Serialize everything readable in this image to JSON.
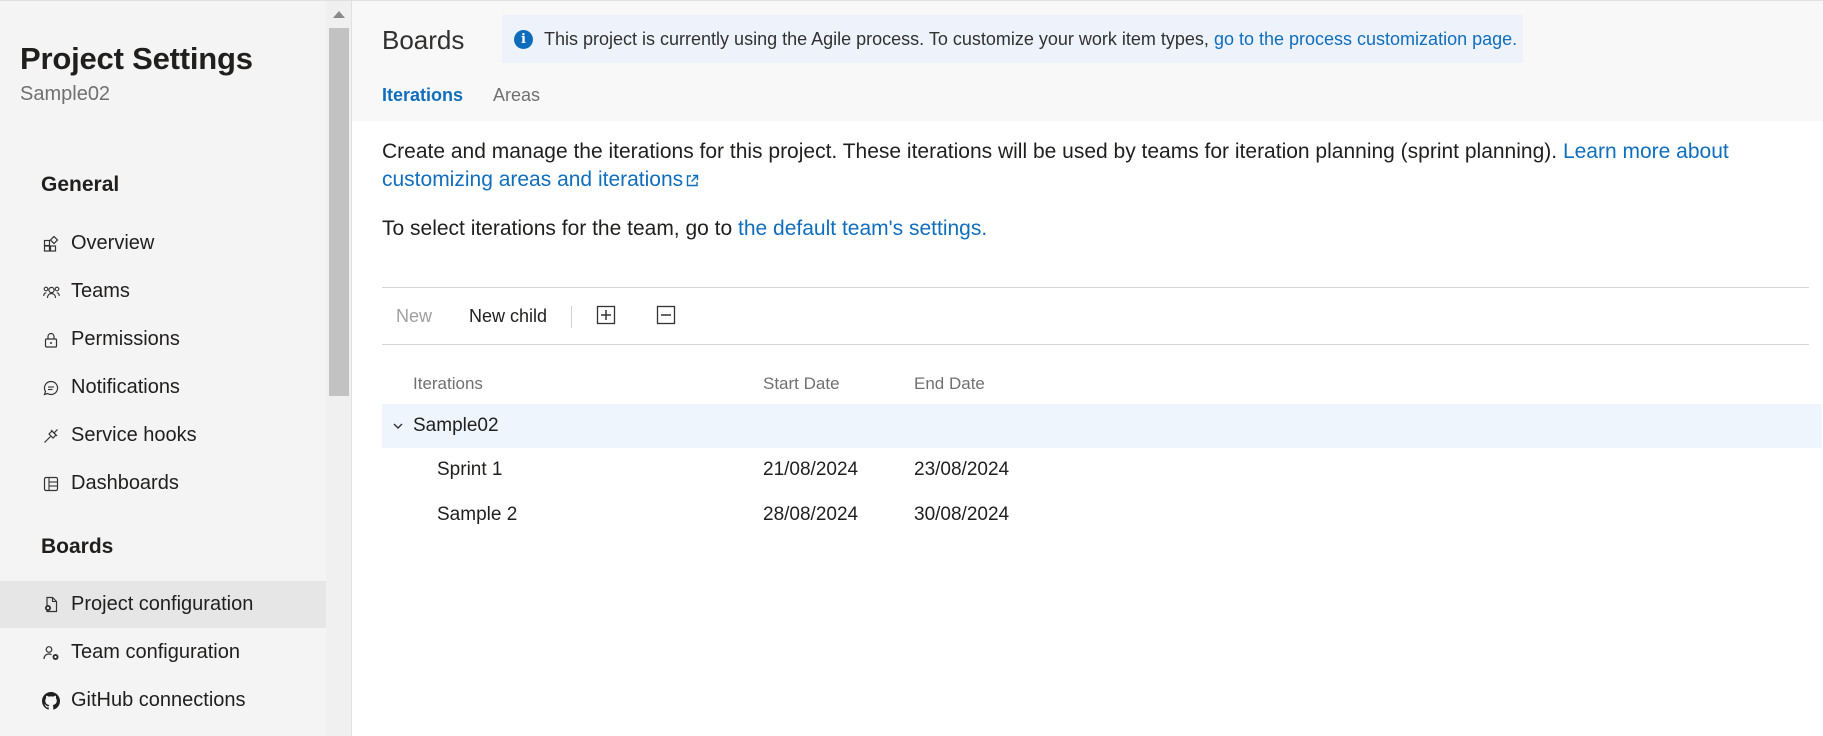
{
  "sidebar": {
    "title": "Project Settings",
    "subtitle": "Sample02",
    "sections": {
      "general": "General",
      "boards": "Boards"
    },
    "general_items": [
      {
        "label": "Overview",
        "icon": "overview-icon"
      },
      {
        "label": "Teams",
        "icon": "teams-icon"
      },
      {
        "label": "Permissions",
        "icon": "lock-icon"
      },
      {
        "label": "Notifications",
        "icon": "chat-bubble-icon"
      },
      {
        "label": "Service hooks",
        "icon": "plug-icon"
      },
      {
        "label": "Dashboards",
        "icon": "dashboard-icon"
      }
    ],
    "boards_items": [
      {
        "label": "Project configuration",
        "icon": "document-gear-icon",
        "selected": true
      },
      {
        "label": "Team configuration",
        "icon": "team-gear-icon",
        "selected": false
      },
      {
        "label": "GitHub connections",
        "icon": "github-icon",
        "selected": false
      }
    ]
  },
  "header": {
    "title": "Boards",
    "banner": {
      "icon": "info-icon",
      "text": "This project is currently using the Agile process. To customize your work item types,",
      "link": "go to the process customization page."
    },
    "tabs": [
      {
        "label": "Iterations",
        "active": true
      },
      {
        "label": "Areas",
        "active": false
      }
    ]
  },
  "content": {
    "description": "Create and manage the iterations for this project. These iterations will be used by teams for iteration planning (sprint planning).",
    "description_link": "Learn more about customizing areas and iterations",
    "team_text": "To select iterations for the team, go to",
    "team_link": "the default team's settings."
  },
  "toolbar": {
    "new_label": "New",
    "new_child_label": "New child",
    "expand_icon": "expand-all-icon",
    "collapse_icon": "collapse-all-icon"
  },
  "table": {
    "columns": [
      "Iterations",
      "Start Date",
      "End Date"
    ],
    "root": {
      "name": "Sample02",
      "expanded": true
    },
    "rows": [
      {
        "name": "Sprint 1",
        "start": "21/08/2024",
        "end": "23/08/2024"
      },
      {
        "name": "Sample 2",
        "start": "28/08/2024",
        "end": "30/08/2024"
      }
    ]
  },
  "colors": {
    "accent": "#106ebe",
    "sidebar_bg": "#f4f4f4",
    "selected_nav": "#e6e6e6",
    "banner_bg": "#eef3fb",
    "selected_row": "#eef5fc"
  }
}
